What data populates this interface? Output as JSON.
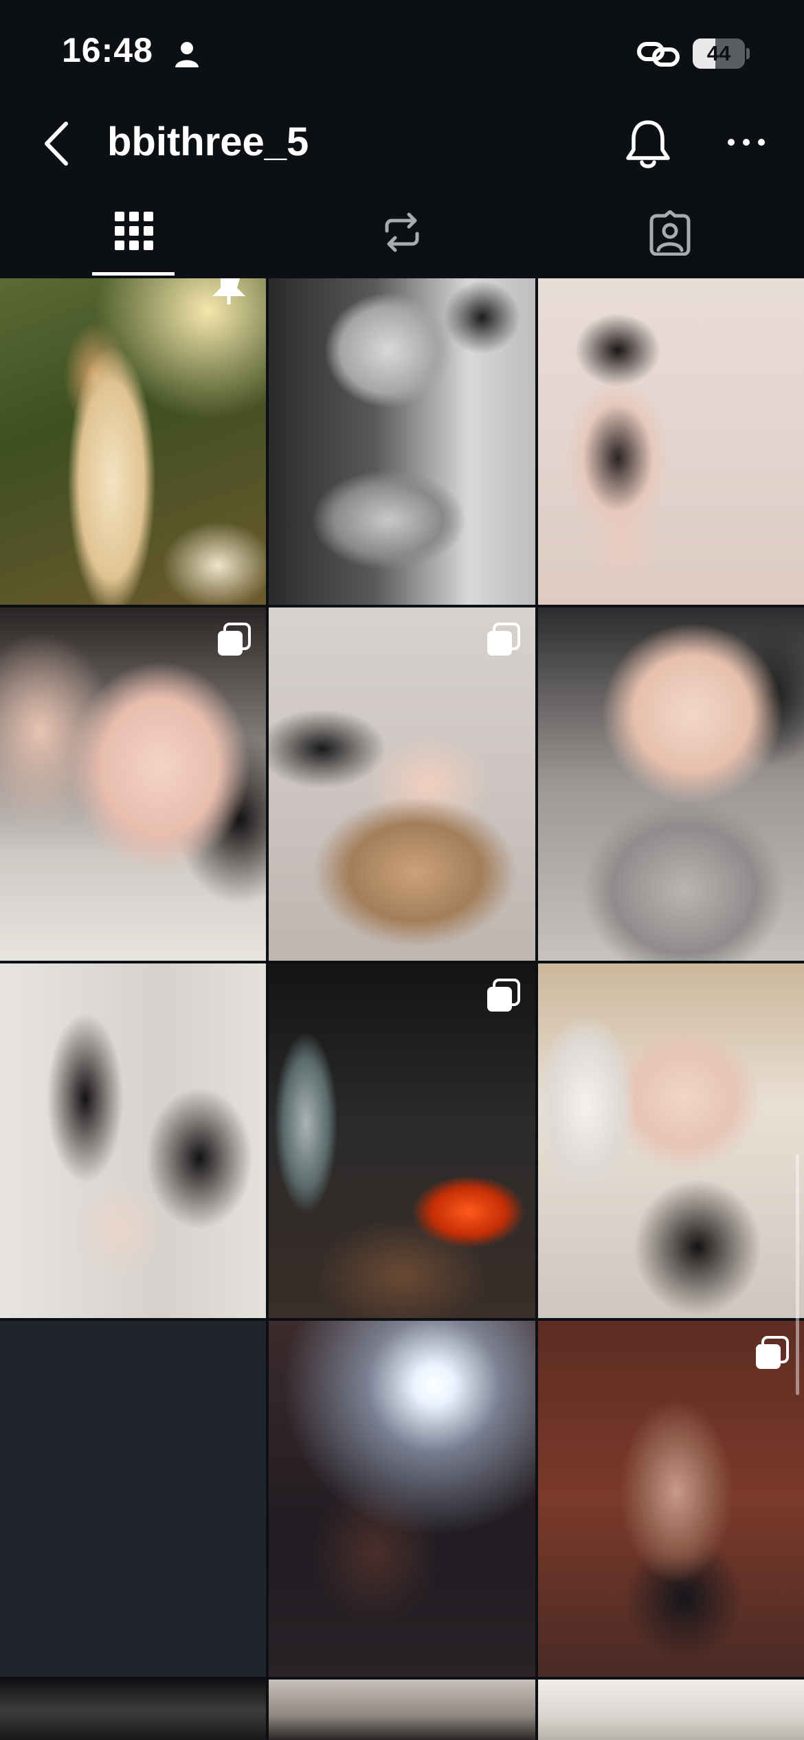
{
  "status_bar": {
    "time": "16:48",
    "battery": "44",
    "battery_level": 0.44
  },
  "header": {
    "username": "bbithree_5"
  },
  "tabs": [
    {
      "name": "posts-grid",
      "icon": "grid-icon",
      "selected": true
    },
    {
      "name": "reposts",
      "icon": "repost-icon",
      "selected": false
    },
    {
      "name": "tagged",
      "icon": "tagged-icon",
      "selected": false
    }
  ],
  "grid": {
    "rows": [
      [
        {
          "icon": "pin-icon"
        },
        {},
        {}
      ],
      [
        {
          "icon": "carousel-icon"
        },
        {
          "icon": "carousel-icon"
        },
        {}
      ],
      [
        {},
        {
          "icon": "carousel-icon"
        },
        {}
      ],
      [
        {},
        {},
        {
          "icon": "carousel-icon"
        }
      ]
    ]
  }
}
